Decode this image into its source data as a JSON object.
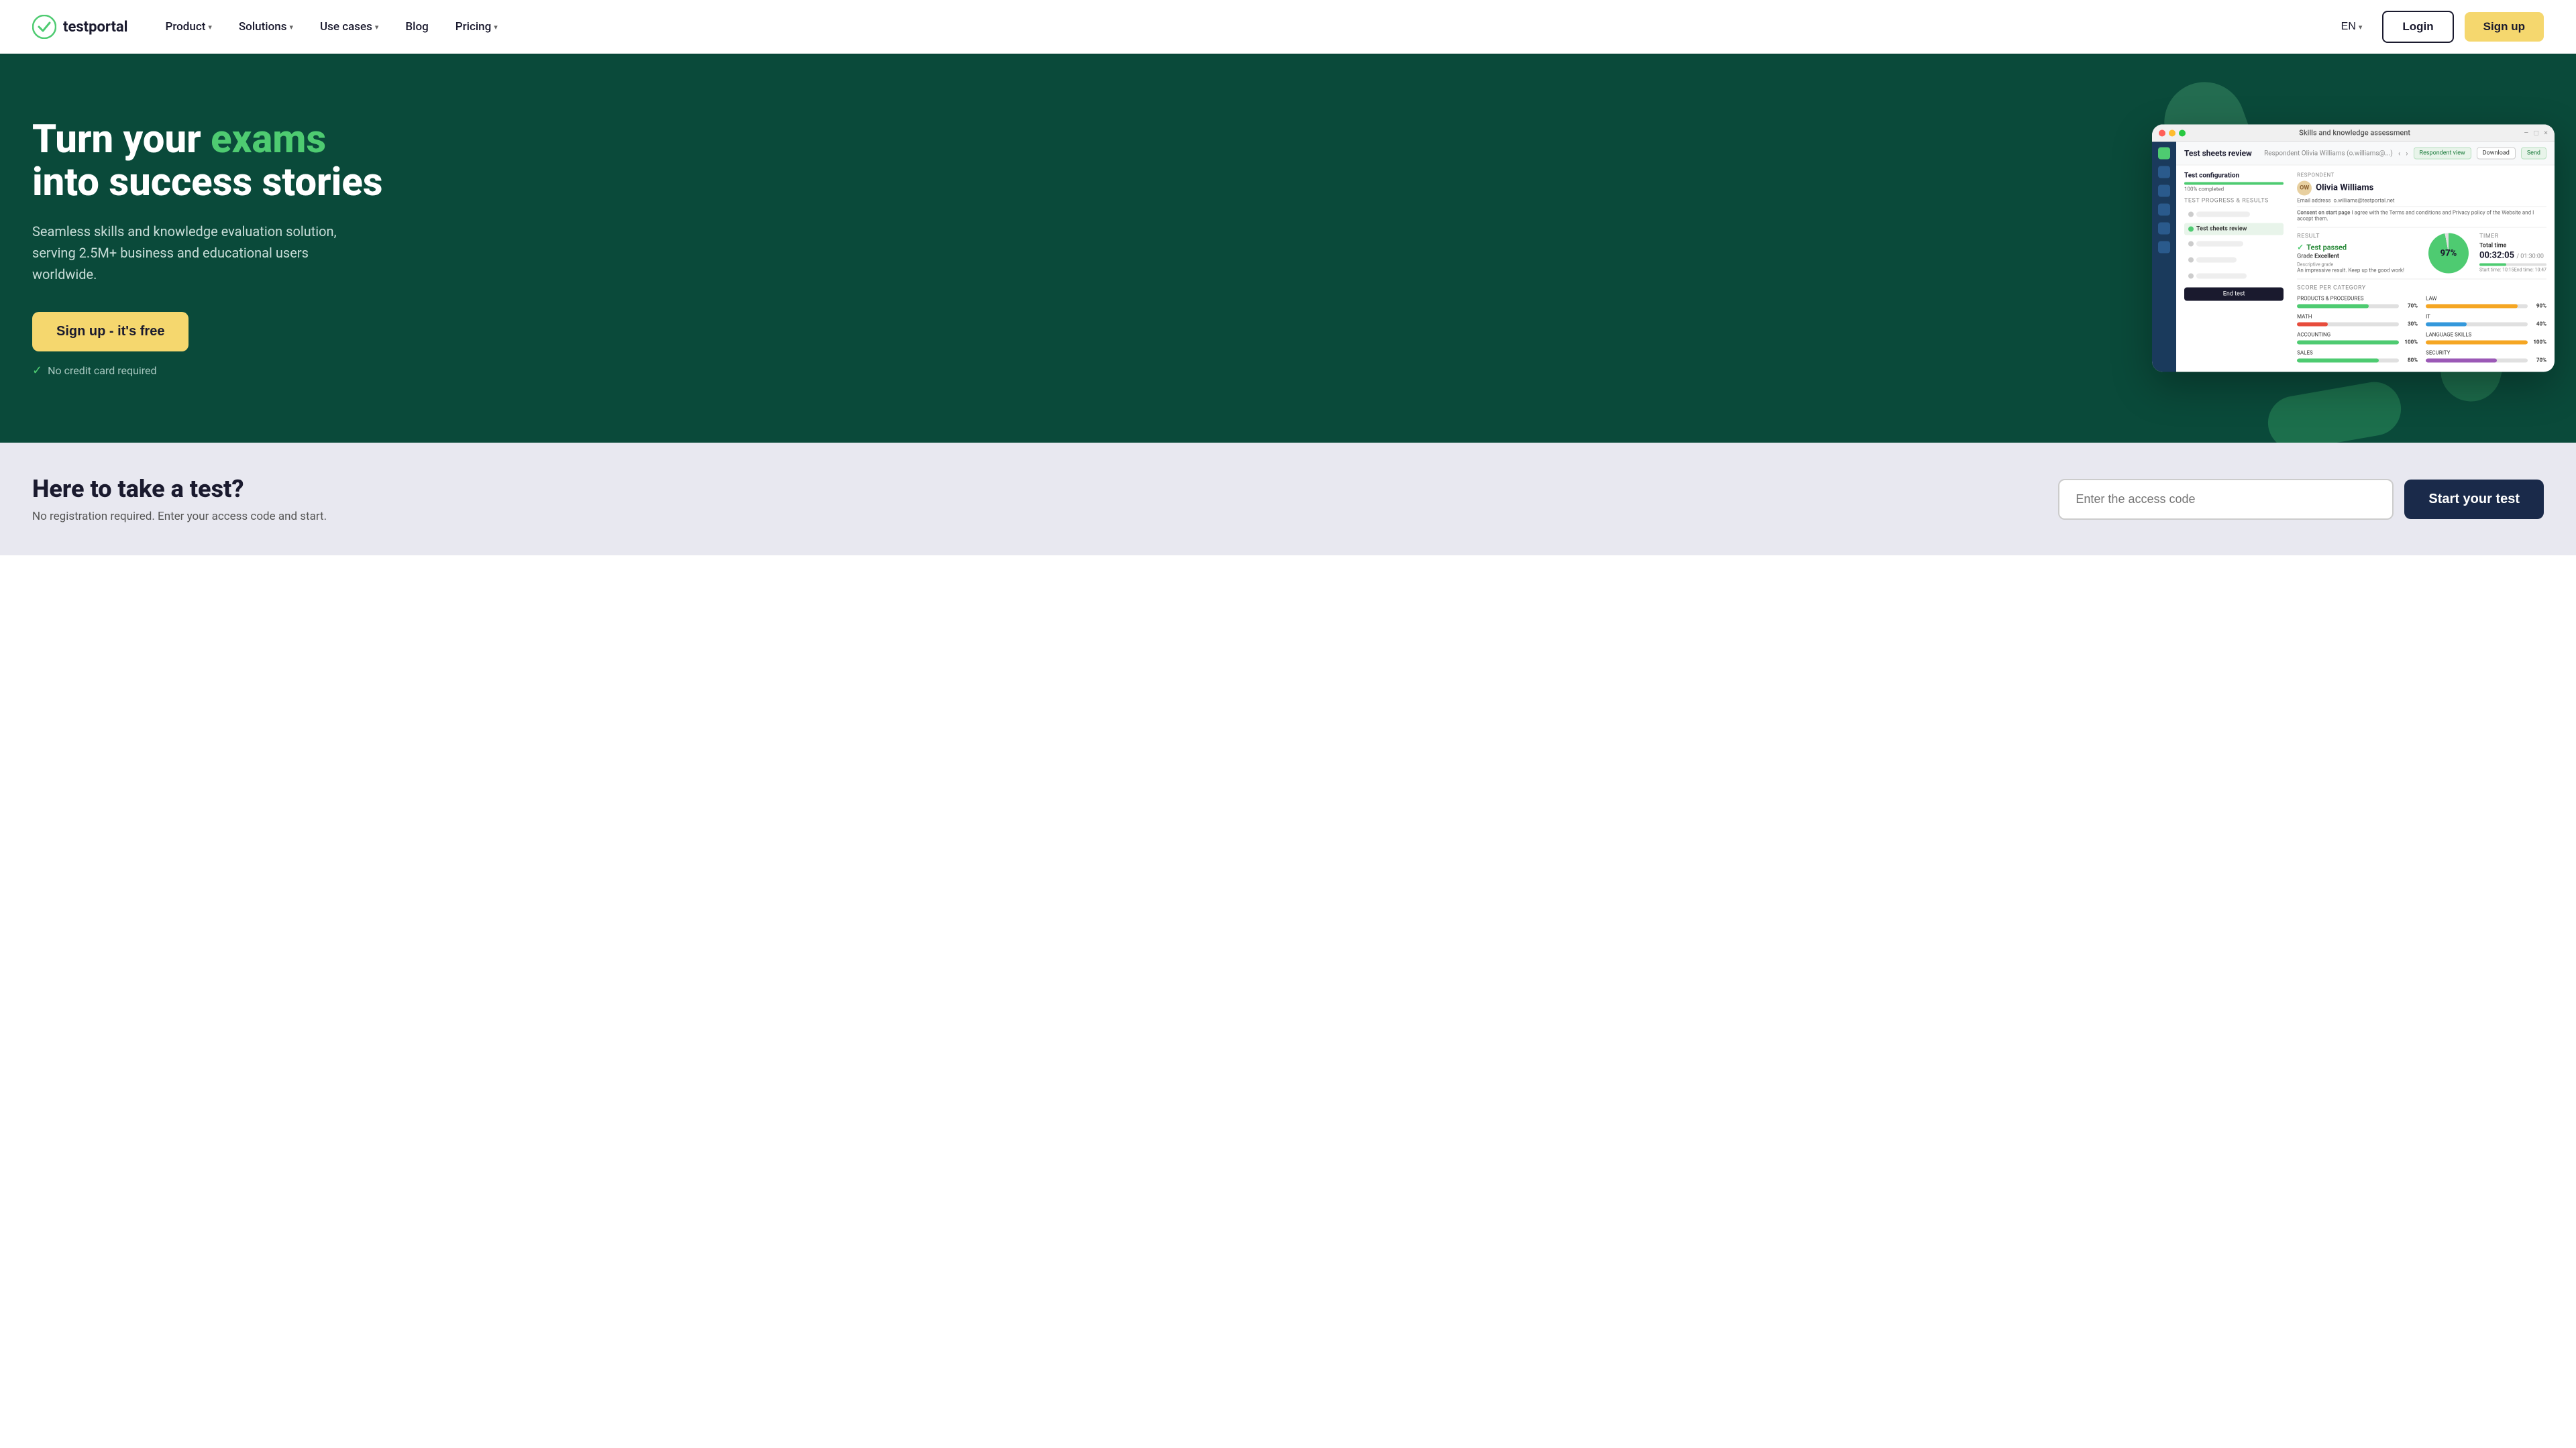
{
  "navbar": {
    "logo_text": "testportal",
    "nav_items": [
      {
        "label": "Product",
        "has_dropdown": true
      },
      {
        "label": "Solutions",
        "has_dropdown": true
      },
      {
        "label": "Use cases",
        "has_dropdown": true
      },
      {
        "label": "Blog",
        "has_dropdown": false
      },
      {
        "label": "Pricing",
        "has_dropdown": true
      }
    ],
    "lang": "EN",
    "login_label": "Login",
    "signup_label": "Sign up"
  },
  "hero": {
    "title_part1": "Turn your ",
    "title_accent": "exams",
    "title_part2": "into success stories",
    "subtitle": "Seamless skills and knowledge evaluation solution, serving 2.5M+ business and educational users worldwide.",
    "cta_label": "Sign up - it's free",
    "no_cc_label": "No credit card required"
  },
  "dashboard": {
    "window_title": "Skills and knowledge assessment",
    "header_title": "Test sheets review",
    "respondent_label": "Respondent",
    "respondent_name_display": "Olivia Williams (o.williams@...)",
    "nav_prev": "‹",
    "nav_next": "›",
    "respondent_view_btn": "Respondent view",
    "download_btn": "Download",
    "send_btn": "Send",
    "config_title": "Test configuration",
    "config_pct": "100% completed",
    "progress_section": "Test progress & results",
    "test_sheets_label": "Test sheets review",
    "end_test_btn": "End test",
    "respondent_section": "RESPONDENT",
    "respondent_full_name": "Olivia Williams",
    "email_label": "Email address",
    "email_value": "o.williams@testportal.net",
    "consent_label": "Consent on start page",
    "consent_text": "I agree with the Terms and conditions and Privacy policy of the Website and I accept them.",
    "result_title": "RESULT",
    "result_status": "Test passed",
    "grade_label": "Grade",
    "grade_value": "Excellent",
    "descriptive_grade_label": "Descriptive grade",
    "descriptive_grade_value": "An impressive result. Keep up the good work!",
    "timer_title": "TIMER",
    "total_time_label": "Total time",
    "total_time_value": "00:32:05",
    "total_time_limit": "/ 01:30:00",
    "start_time_label": "Start time",
    "start_time_value": "10:15",
    "end_time_label": "End time",
    "end_time_value": "10:47",
    "score_section": "SCORE PER CATEGORY",
    "score_items": [
      {
        "name": "PRODUCTS & PROCEDURES",
        "pct": 70,
        "color": "#4ecb71"
      },
      {
        "name": "LAW",
        "pct": 90,
        "color": "#f5a623"
      },
      {
        "name": "MATH",
        "pct": 30,
        "color": "#e74c3c"
      },
      {
        "name": "IT",
        "pct": 40,
        "color": "#3498db"
      },
      {
        "name": "ACCOUNTING",
        "pct": 100,
        "color": "#4ecb71"
      },
      {
        "name": "LANGUAGE SKILLS",
        "pct": 100,
        "color": "#f5a623"
      },
      {
        "name": "SALES",
        "pct": 80,
        "color": "#4ecb71"
      },
      {
        "name": "SECURITY",
        "pct": 70,
        "color": "#9b59b6"
      }
    ],
    "score_pct": "97%"
  },
  "take_test": {
    "title": "Here to take a test?",
    "subtitle": "No registration required. Enter your access code and start.",
    "input_placeholder": "Enter the access code",
    "start_btn_label": "Start your test"
  }
}
